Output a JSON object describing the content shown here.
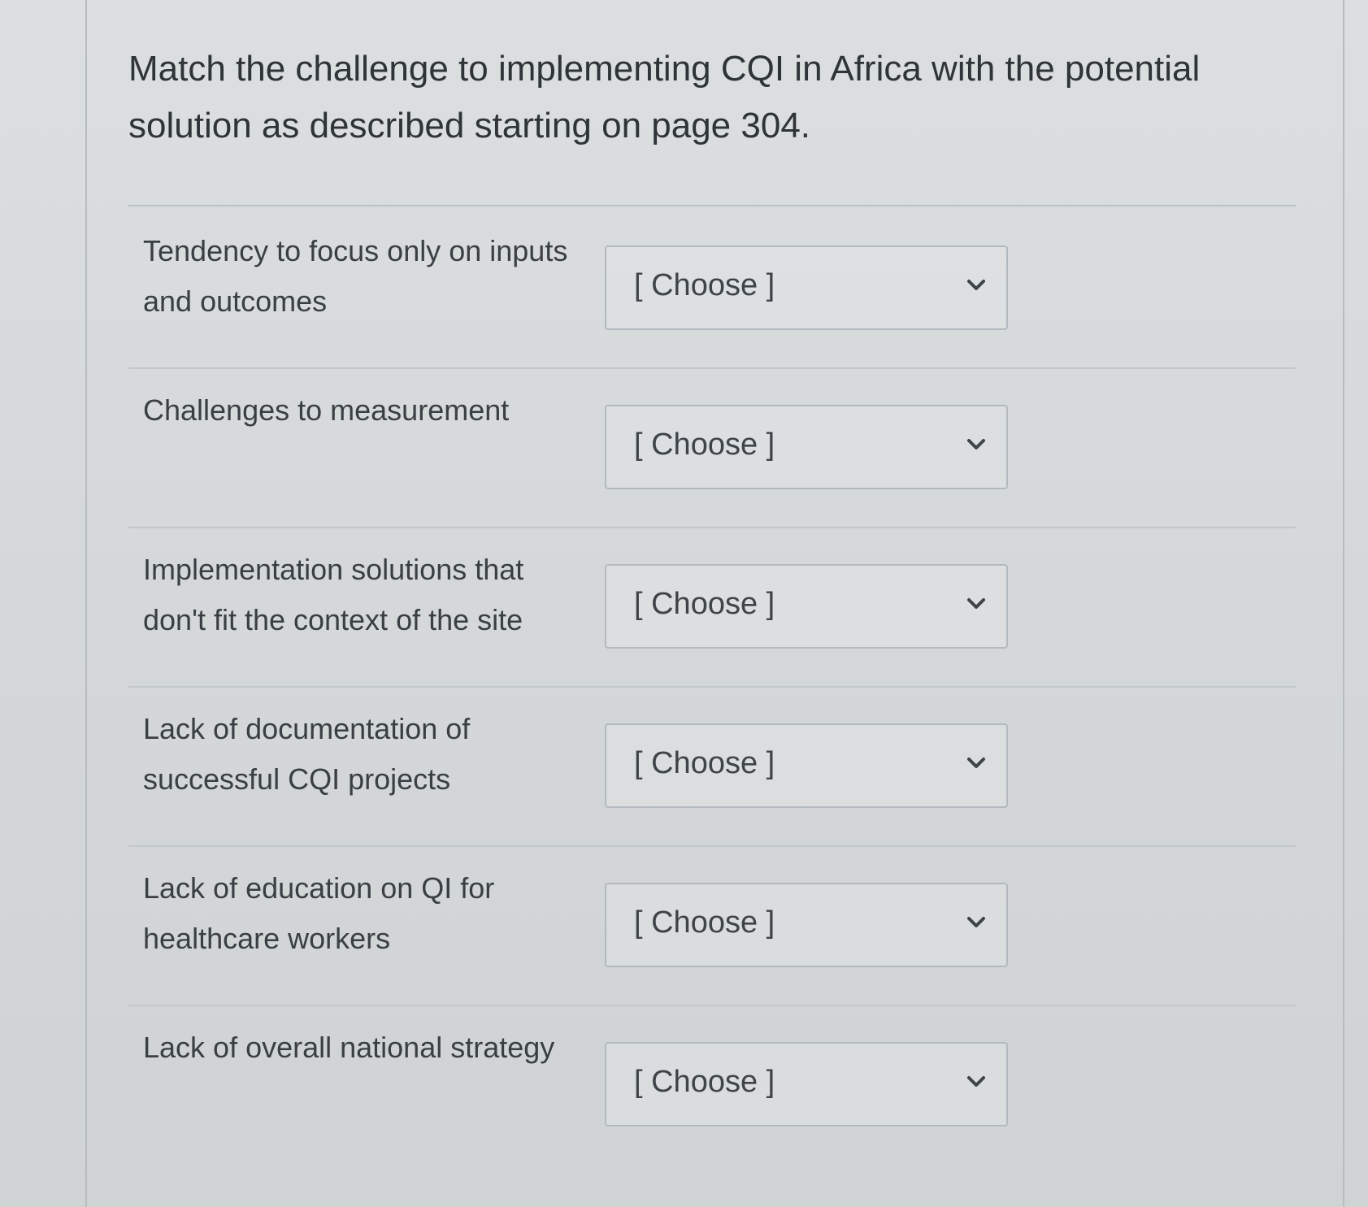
{
  "question": {
    "text": "Match the challenge to implementing CQI in Africa with the potential solution as described starting on page 304."
  },
  "matches": [
    {
      "prompt": "Tendency to focus only on inputs and outcomes",
      "selected": "[ Choose ]"
    },
    {
      "prompt": "Challenges to measurement",
      "selected": "[ Choose ]"
    },
    {
      "prompt": "Implementation solutions that don't fit the context of the site",
      "selected": "[ Choose ]"
    },
    {
      "prompt": "Lack of documentation of successful CQI projects",
      "selected": "[ Choose ]"
    },
    {
      "prompt": "Lack of education on QI for healthcare workers",
      "selected": "[ Choose ]"
    },
    {
      "prompt": "Lack of overall national strategy",
      "selected": "[ Choose ]"
    }
  ],
  "icons": {
    "dropdown": "chevron-down-icon"
  },
  "colors": {
    "text": "#2f3438",
    "border": "#b3babf",
    "background": "#d6dadb"
  }
}
